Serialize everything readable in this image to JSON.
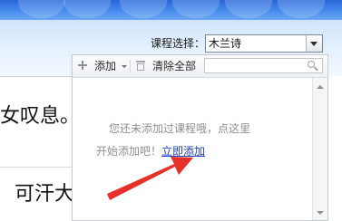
{
  "header": {
    "course_label": "课程选择：",
    "course_selected": "木兰诗"
  },
  "toolbar": {
    "add_label": "添加",
    "clear_all_label": "清除全部",
    "search_placeholder": ""
  },
  "empty_state": {
    "line1": "您还未添加过课程哦，点这里",
    "line2_prefix": "开始添加吧！",
    "add_now_link": "立即添加"
  },
  "background_page": {
    "line1": "女叹息。",
    "line2": "可汗大"
  },
  "colors": {
    "header_blue": "#3f85ea",
    "link_blue": "#1f3fbf",
    "hint_gray": "#8f8f8f",
    "annotation_red": "#e8302a"
  },
  "icons": {
    "add": "plus-icon",
    "clear": "trash-icon",
    "search": "magnifier-icon",
    "dropdown": "chevron-down-icon"
  }
}
